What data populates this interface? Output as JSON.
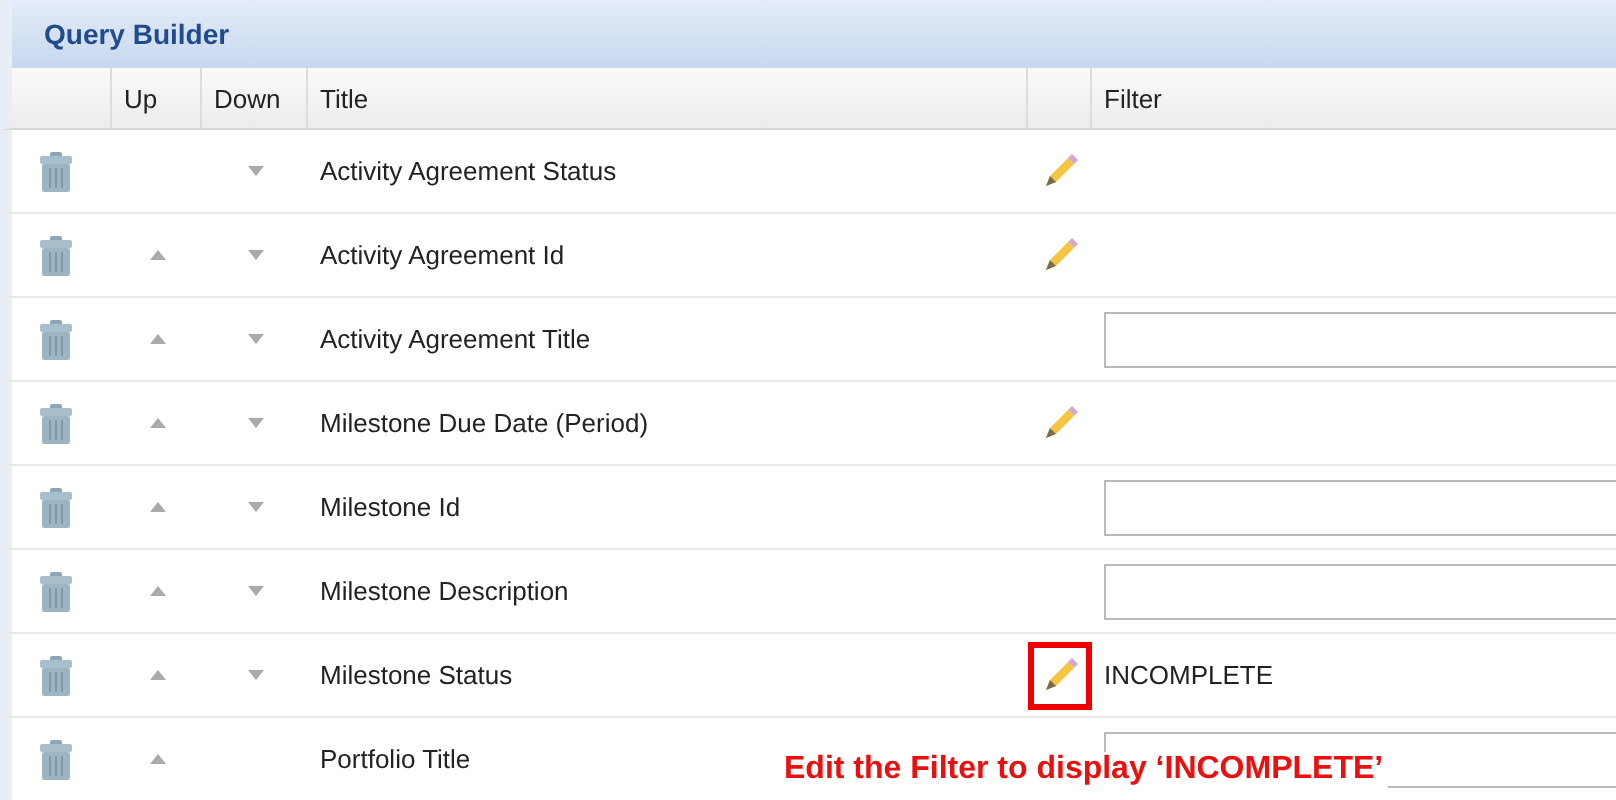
{
  "panel": {
    "title": "Query Builder"
  },
  "columns": [
    "Up",
    "Down",
    "Title",
    "Filter"
  ],
  "rows": [
    {
      "up": false,
      "down": true,
      "title": "Activity Agreement Status",
      "filter": {
        "kind": "edit"
      },
      "highlighted": false
    },
    {
      "up": true,
      "down": true,
      "title": "Activity Agreement Id",
      "filter": {
        "kind": "edit"
      },
      "highlighted": false
    },
    {
      "up": true,
      "down": true,
      "title": "Activity Agreement Title",
      "filter": {
        "kind": "text"
      },
      "highlighted": false
    },
    {
      "up": true,
      "down": true,
      "title": "Milestone Due Date (Period)",
      "filter": {
        "kind": "edit"
      },
      "highlighted": false
    },
    {
      "up": true,
      "down": true,
      "title": "Milestone Id",
      "filter": {
        "kind": "text"
      },
      "highlighted": false
    },
    {
      "up": true,
      "down": true,
      "title": "Milestone Description",
      "filter": {
        "kind": "text"
      },
      "highlighted": false
    },
    {
      "up": true,
      "down": true,
      "title": "Milestone Status",
      "filter": {
        "kind": "edit",
        "value": "INCOMPLETE"
      },
      "highlighted": true
    },
    {
      "up": true,
      "down": false,
      "title": "Portfolio Title",
      "filter": {
        "kind": "text"
      },
      "highlighted": false
    }
  ],
  "annotation": {
    "text": "Edit the Filter to display ‘INCOMPLETE’"
  }
}
